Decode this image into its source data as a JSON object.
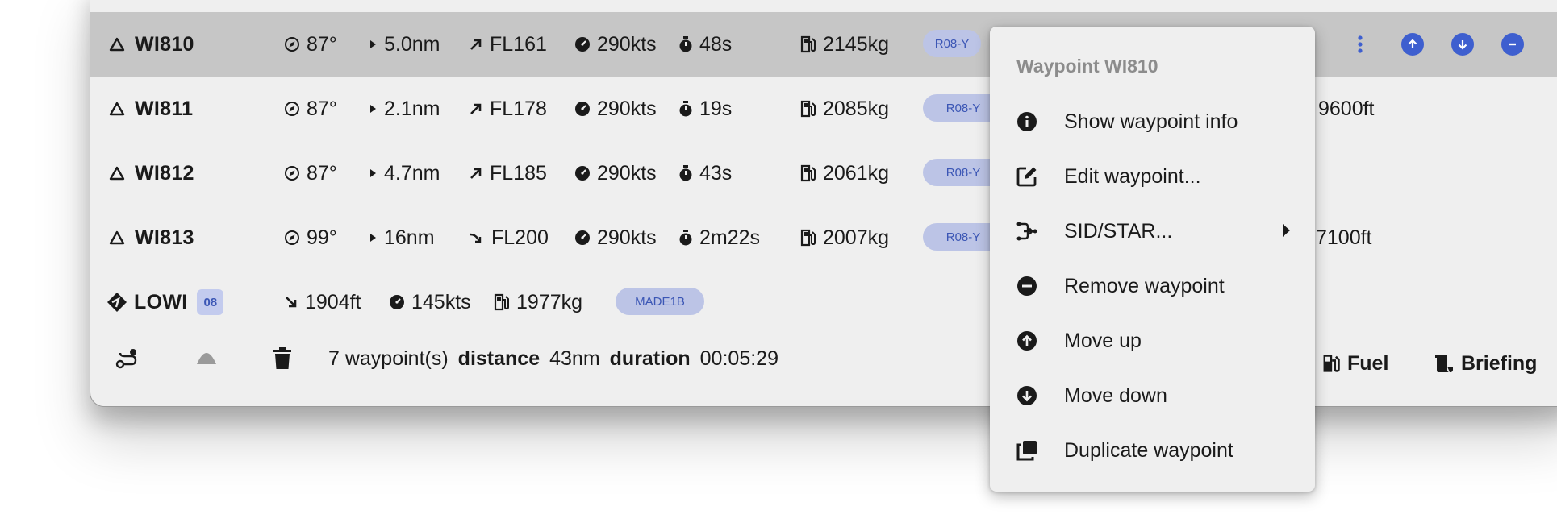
{
  "waypoints": [
    {
      "name": "WI810",
      "heading": "87°",
      "distance": "5.0nm",
      "altitude": "FL161",
      "speed": "290kts",
      "time": "48s",
      "fuel": "2145kg",
      "tag": "R08-Y",
      "extra": ""
    },
    {
      "name": "WI811",
      "heading": "87°",
      "distance": "2.1nm",
      "altitude": "FL178",
      "speed": "290kts",
      "time": "19s",
      "fuel": "2085kg",
      "tag": "R08-Y",
      "extra": "9600ft"
    },
    {
      "name": "WI812",
      "heading": "87°",
      "distance": "4.7nm",
      "altitude": "FL185",
      "speed": "290kts",
      "time": "43s",
      "fuel": "2061kg",
      "tag": "R08-Y",
      "extra": ""
    },
    {
      "name": "WI813",
      "heading": "99°",
      "distance": "16nm",
      "altitude": "FL200",
      "speed": "290kts",
      "time": "2m22s",
      "fuel": "2007kg",
      "tag": "R08-Y",
      "extra": "7100ft"
    }
  ],
  "destination": {
    "name": "LOWI",
    "runway": "08",
    "altitude": "1904ft",
    "speed": "145kts",
    "fuel": "1977kg",
    "tag": "MADE1B"
  },
  "footer": {
    "waypoint_count": "7 waypoint(s)",
    "distance_label": "distance",
    "distance_value": "43nm",
    "duration_label": "duration",
    "duration_value": "00:05:29",
    "fuel_label": "Fuel",
    "briefing_label": "Briefing"
  },
  "context_menu": {
    "title": "Waypoint WI810",
    "items": [
      {
        "label": "Show waypoint info",
        "icon": "info-icon"
      },
      {
        "label": "Edit waypoint...",
        "icon": "edit-icon"
      },
      {
        "label": "SID/STAR...",
        "icon": "sid-star-icon",
        "submenu": true
      },
      {
        "label": "Remove waypoint",
        "icon": "remove-icon"
      },
      {
        "label": "Move up",
        "icon": "arrow-up-circle-icon"
      },
      {
        "label": "Move down",
        "icon": "arrow-down-circle-icon"
      },
      {
        "label": "Duplicate waypoint",
        "icon": "duplicate-icon"
      }
    ]
  },
  "colors": {
    "accent": "#3e5fcf",
    "badge_bg": "#bcc4e6",
    "selected_row": "#c6c6c6",
    "panel_bg": "#efefef"
  }
}
